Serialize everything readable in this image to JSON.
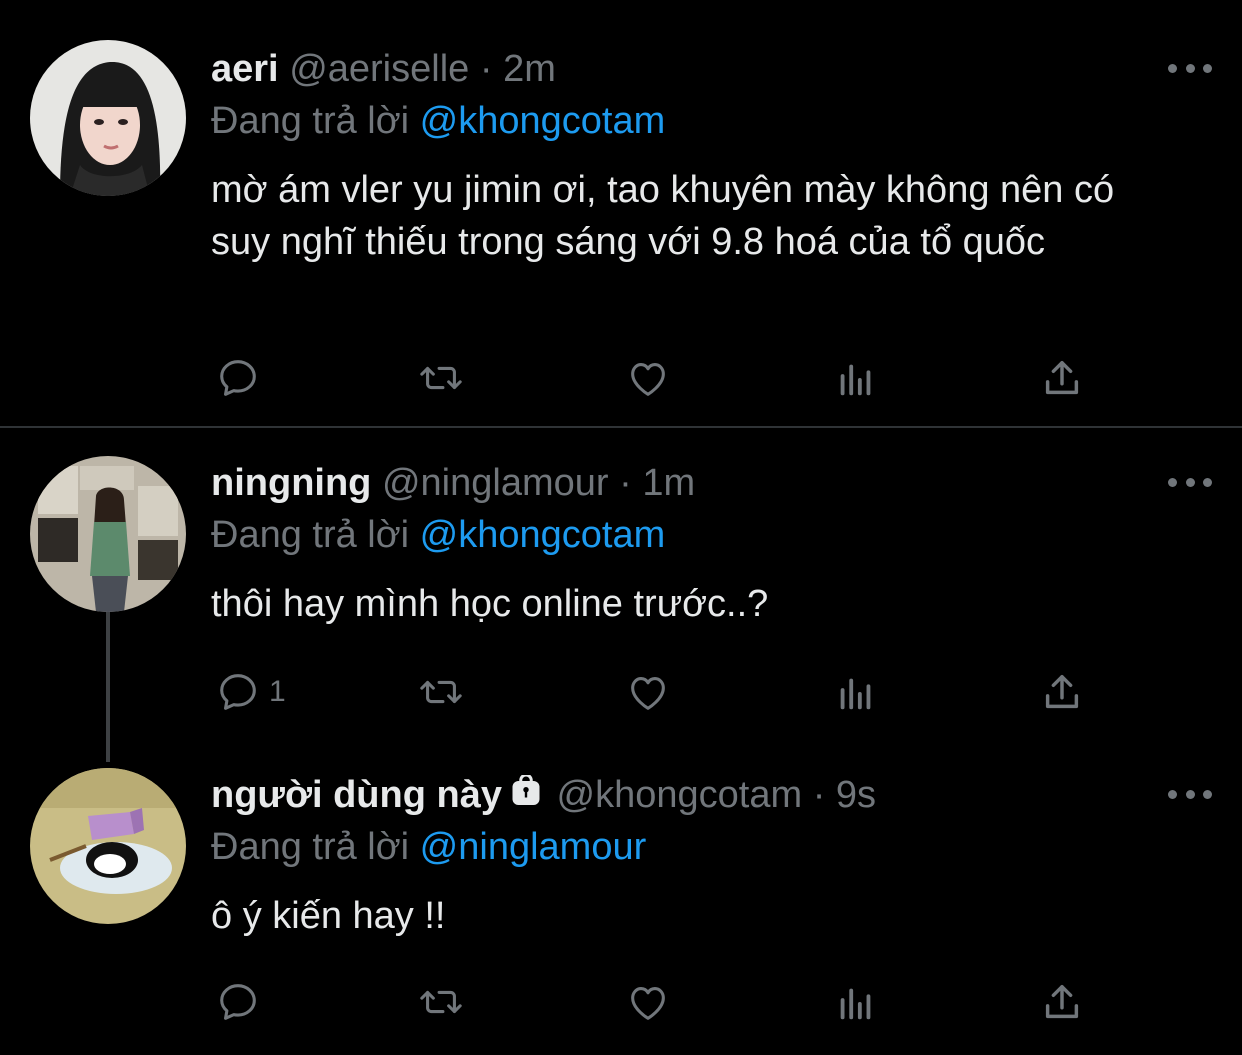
{
  "tweets": [
    {
      "name": "aeri",
      "handle": "@aeriselle",
      "separator": "·",
      "time": "2m",
      "reply_prefix": "Đang trả lời",
      "reply_to": "@khongcotam",
      "text": "mờ ám vler yu jimin ơi, tao khuyên mày không nên có suy nghĩ thiếu trong sáng với 9.8 hoá của tổ quốc",
      "reply_count": ""
    },
    {
      "name": "ningning",
      "handle": "@ninglamour",
      "separator": "·",
      "time": "1m",
      "reply_prefix": "Đang trả lời",
      "reply_to": "@khongcotam",
      "text": "thôi hay mình học online trước..?",
      "reply_count": "1"
    },
    {
      "name": "người dùng này",
      "handle": "@khongcotam",
      "separator": "·",
      "time": "9s",
      "reply_prefix": "Đang trả lời",
      "reply_to": "@ninglamour",
      "text": "ô ý kiến hay !!",
      "reply_count": ""
    }
  ],
  "colors": {
    "background": "#000000",
    "text": "#e7e9ea",
    "muted": "#71767b",
    "accent": "#1d9bf0",
    "divider": "#2f3336"
  },
  "icons": [
    "reply-icon",
    "retweet-icon",
    "like-icon",
    "analytics-icon",
    "share-icon",
    "more-icon",
    "lock-icon"
  ]
}
